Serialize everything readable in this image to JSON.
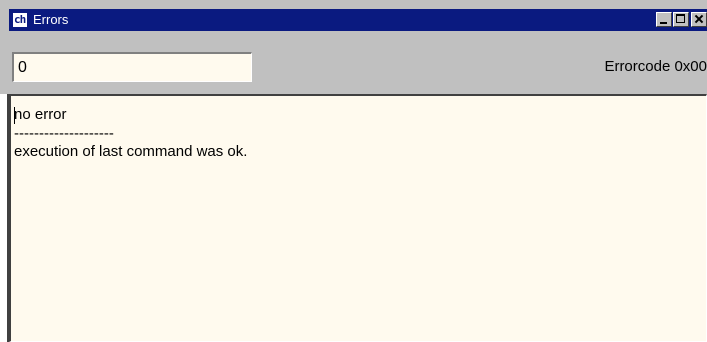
{
  "window": {
    "title": "Errors",
    "app_icon_glyph": "ch",
    "colors": {
      "titlebar": "#0a1a80",
      "chrome": "#c0c0c0",
      "field_background": "#fffaee"
    }
  },
  "toolbar": {
    "code_input_value": "0",
    "errorcode_label": "Errorcode 0x00"
  },
  "output": {
    "lines": [
      "no error",
      "--------------------",
      "execution of last command was ok."
    ]
  }
}
